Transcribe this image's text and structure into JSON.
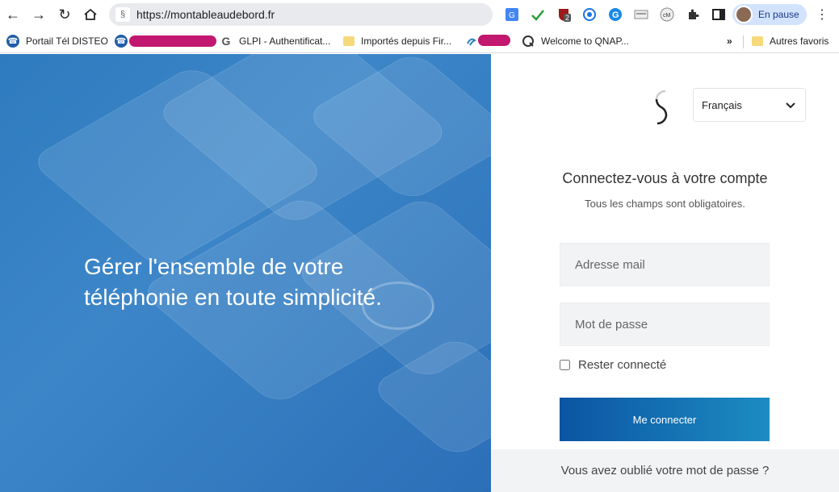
{
  "browser": {
    "url": "https://montableaudebord.fr",
    "profile_label": "En pause",
    "extension_badge": "2",
    "bookmarks": [
      {
        "label": "Portail Tél DISTEO",
        "icon": "phone-icon"
      },
      {
        "label": "",
        "icon": "phone-icon",
        "redacted": true
      },
      {
        "label": "GLPI - Authentificat...",
        "icon": "g-icon"
      },
      {
        "label": "Importés depuis Fir...",
        "icon": "folder-icon"
      },
      {
        "label": "",
        "icon": "swirl-icon",
        "redacted": true
      },
      {
        "label": "Welcome to QNAP...",
        "icon": "qnap-icon"
      }
    ],
    "bookmarks_overflow": "»",
    "other_bookmarks": "Autres favoris"
  },
  "hero": {
    "headline": "Gérer l'ensemble de votre téléphonie en toute simplicité."
  },
  "login": {
    "language": "Français",
    "title": "Connectez-vous à votre compte",
    "subtitle": "Tous les champs sont obligatoires.",
    "email_placeholder": "Adresse mail",
    "password_placeholder": "Mot de passe",
    "remember_label": "Rester connecté",
    "remember_checked": false,
    "submit_label": "Me connecter",
    "forgot_label": "Vous avez oublié votre mot de passe ?"
  },
  "colors": {
    "hero_blue": "#3c86c8",
    "button_start": "#0c54a3",
    "button_end": "#1c8cc2",
    "redaction": "#c2186f"
  }
}
